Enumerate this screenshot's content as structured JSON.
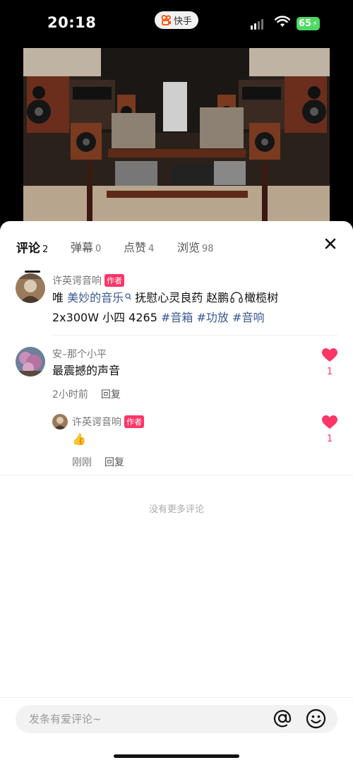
{
  "status_bar": {
    "time": "20:18",
    "app_name": "快手",
    "battery": "65"
  },
  "tabs": [
    {
      "label": "评论",
      "count": "2"
    },
    {
      "label": "弹幕",
      "count": "0"
    },
    {
      "label": "点赞",
      "count": "4"
    },
    {
      "label": "浏览",
      "count": "98"
    }
  ],
  "pinned_comment": {
    "username": "许英谔音响",
    "badge": "作者",
    "text_prefix": "唯 ",
    "link_text": "美妙的音乐",
    "text_mid": "  抚慰心灵良药 赵鹏",
    "text_mid2": "橄榄树",
    "line2_plain": "2x300W 小四 4265 ",
    "hashtags": [
      "#音箱",
      "#功放",
      "#音响"
    ]
  },
  "comments": [
    {
      "username": "安–那个小平",
      "text": "最震撼的声音",
      "time": "2小时前",
      "reply_label": "回复",
      "likes": "1",
      "replies": [
        {
          "username": "许英谔音响",
          "badge": "作者",
          "text": "👍",
          "time": "刚刚",
          "reply_label": "回复",
          "likes": "1"
        }
      ]
    }
  ],
  "footer_text": "没有更多评论",
  "input": {
    "placeholder": "发条有爱评论~"
  },
  "colors": {
    "accent": "#fe3666",
    "topic": "#3b5a8f",
    "battery": "#4cd964"
  }
}
